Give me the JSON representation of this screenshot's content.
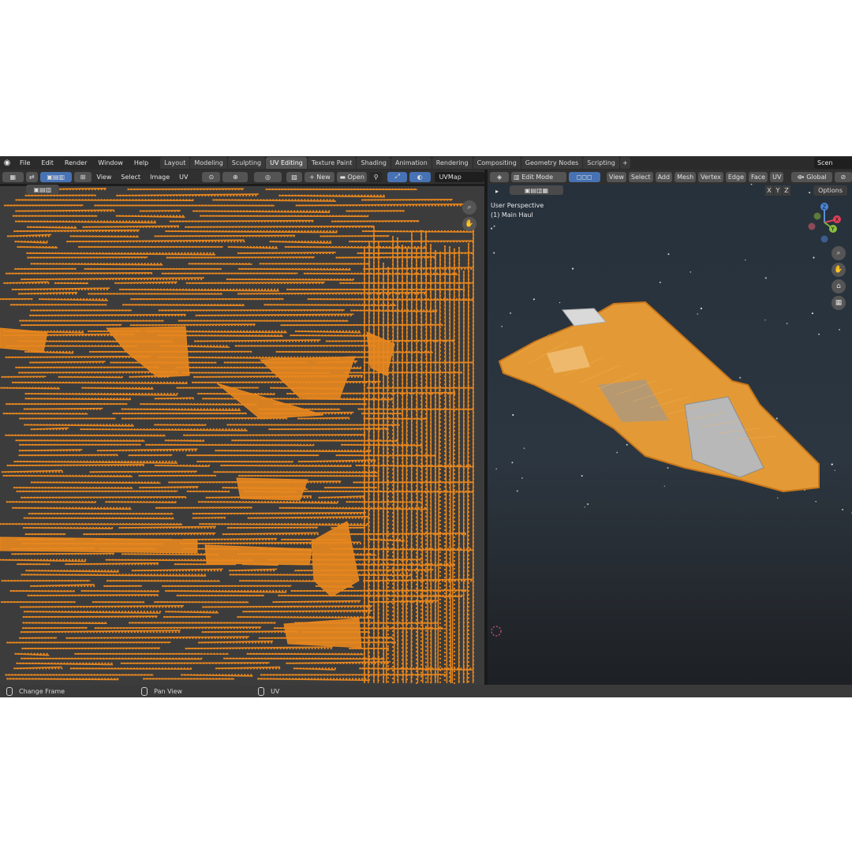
{
  "menu": [
    "File",
    "Edit",
    "Render",
    "Window",
    "Help"
  ],
  "workspaces": [
    {
      "label": "Layout",
      "active": false
    },
    {
      "label": "Modeling",
      "active": false
    },
    {
      "label": "Sculpting",
      "active": false
    },
    {
      "label": "UV Editing",
      "active": true
    },
    {
      "label": "Texture Paint",
      "active": false
    },
    {
      "label": "Shading",
      "active": false
    },
    {
      "label": "Animation",
      "active": false
    },
    {
      "label": "Rendering",
      "active": false
    },
    {
      "label": "Compositing",
      "active": false
    },
    {
      "label": "Geometry Nodes",
      "active": false
    },
    {
      "label": "Scripting",
      "active": false
    }
  ],
  "add_workspace": "+",
  "scene_label": "Scen",
  "uv_editor": {
    "menus": [
      "View",
      "Select",
      "Image",
      "UV"
    ],
    "new_button": "New",
    "new_icon": "+",
    "open_button": "Open",
    "uv_map": "UVMap"
  },
  "viewport": {
    "mode": "Edit Mode",
    "menus": [
      "View",
      "Select",
      "Add",
      "Mesh",
      "Vertex",
      "Edge",
      "Face",
      "UV"
    ],
    "transform": "Global",
    "perspective": "User Perspective",
    "object": "(1) Main Haul",
    "axes": [
      "X",
      "Y",
      "Z"
    ],
    "options": "Options",
    "gizmo_labels": {
      "x": "X",
      "y": "Y",
      "z": "Z"
    }
  },
  "status": {
    "left": "Change Frame",
    "middle": "Pan View",
    "right": "UV"
  },
  "colors": {
    "accent": "#e8871e",
    "uv_background": "#3c3c3c",
    "selection_blue": "#4772b3"
  }
}
